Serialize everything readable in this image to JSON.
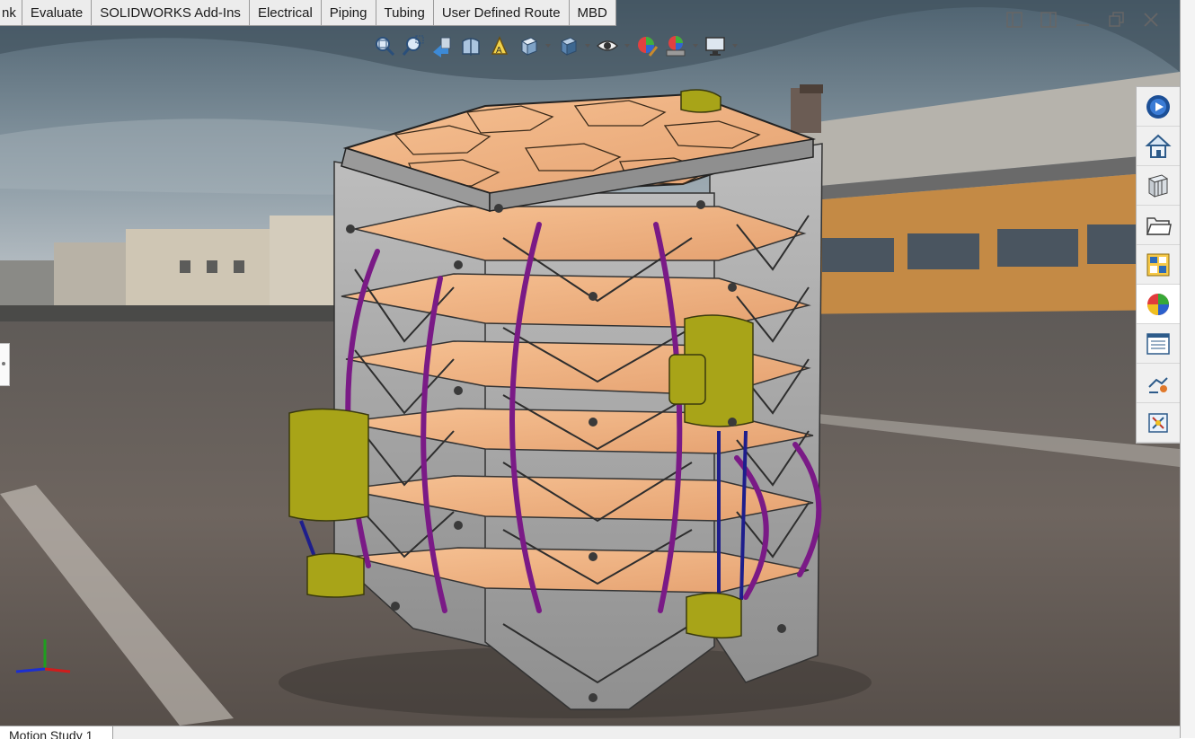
{
  "tabs": [
    {
      "label": "nk"
    },
    {
      "label": "Evaluate"
    },
    {
      "label": "SOLIDWORKS Add-Ins"
    },
    {
      "label": "Electrical"
    },
    {
      "label": "Piping"
    },
    {
      "label": "Tubing"
    },
    {
      "label": "User Defined Route"
    },
    {
      "label": "MBD"
    }
  ],
  "heads_up_toolbar": [
    {
      "icon": "zoom-to-fit-icon"
    },
    {
      "icon": "zoom-to-area-icon"
    },
    {
      "icon": "previous-view-icon"
    },
    {
      "icon": "section-view-icon"
    },
    {
      "icon": "dynamic-annotation-views-icon"
    },
    {
      "icon": "view-orientation-icon"
    },
    {
      "icon": "display-style-icon"
    },
    {
      "icon": "hide-show-items-icon"
    },
    {
      "icon": "edit-appearance-icon"
    },
    {
      "icon": "apply-scene-icon"
    },
    {
      "icon": "view-settings-icon"
    }
  ],
  "task_pane": [
    {
      "icon": "solidworks-resources-icon"
    },
    {
      "icon": "home-icon"
    },
    {
      "icon": "design-library-icon"
    },
    {
      "icon": "file-explorer-icon"
    },
    {
      "icon": "view-palette-icon"
    },
    {
      "icon": "appearances-scenes-decals-icon"
    },
    {
      "icon": "custom-properties-icon"
    },
    {
      "icon": "solidworks-forum-icon"
    },
    {
      "icon": "electrical-routing-icon"
    }
  ],
  "motion_tab_label": "Motion Study 1",
  "colors": {
    "plate": "#f2b482",
    "frame": "#a6a6a6",
    "tube": "#7a1a86",
    "clamp": "#a8a418",
    "blue_tube": "#1e1e8c"
  }
}
